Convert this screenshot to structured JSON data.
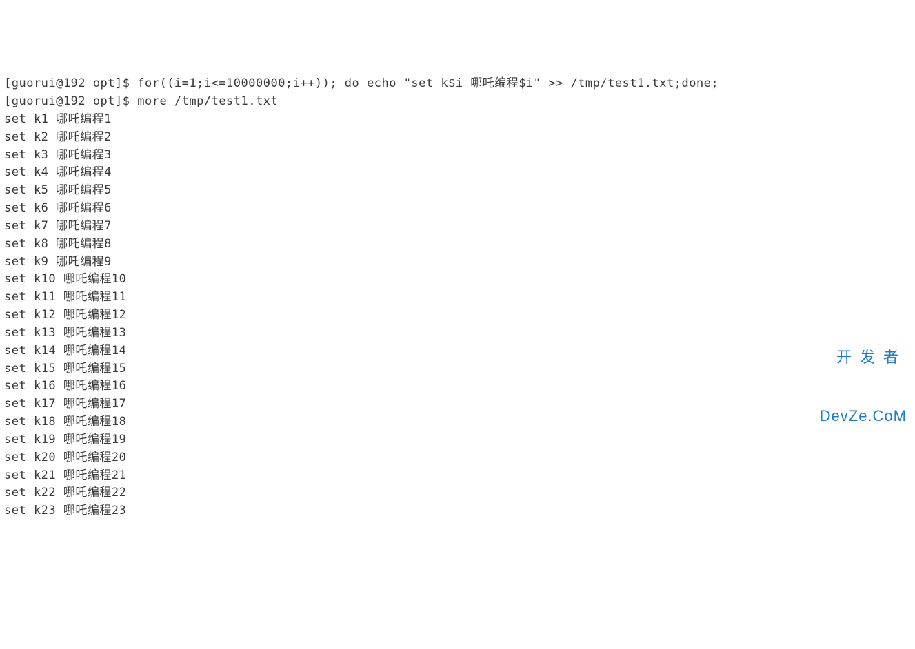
{
  "prompt1": {
    "user_host": "[guorui@192 opt]$ ",
    "command": "for((i=1;i<=10000000;i++)); do echo \"set k$i 哪吒编程$i\" >> /tmp/test1.txt;done;"
  },
  "prompt2": {
    "user_host": "[guorui@192 opt]$ ",
    "command": "more /tmp/test1.txt"
  },
  "output_lines": [
    "set k1 哪吒编程1",
    "set k2 哪吒编程2",
    "set k3 哪吒编程3",
    "set k4 哪吒编程4",
    "set k5 哪吒编程5",
    "set k6 哪吒编程6",
    "set k7 哪吒编程7",
    "set k8 哪吒编程8",
    "set k9 哪吒编程9",
    "set k10 哪吒编程10",
    "set k11 哪吒编程11",
    "set k12 哪吒编程12",
    "set k13 哪吒编程13",
    "set k14 哪吒编程14",
    "set k15 哪吒编程15",
    "set k16 哪吒编程16",
    "set k17 哪吒编程17",
    "set k18 哪吒编程18",
    "set k19 哪吒编程19",
    "set k20 哪吒编程20",
    "set k21 哪吒编程21",
    "set k22 哪吒编程22",
    "set k23 哪吒编程23"
  ],
  "watermark": {
    "line1": "开发者",
    "line2": "DevZe.CoM"
  }
}
